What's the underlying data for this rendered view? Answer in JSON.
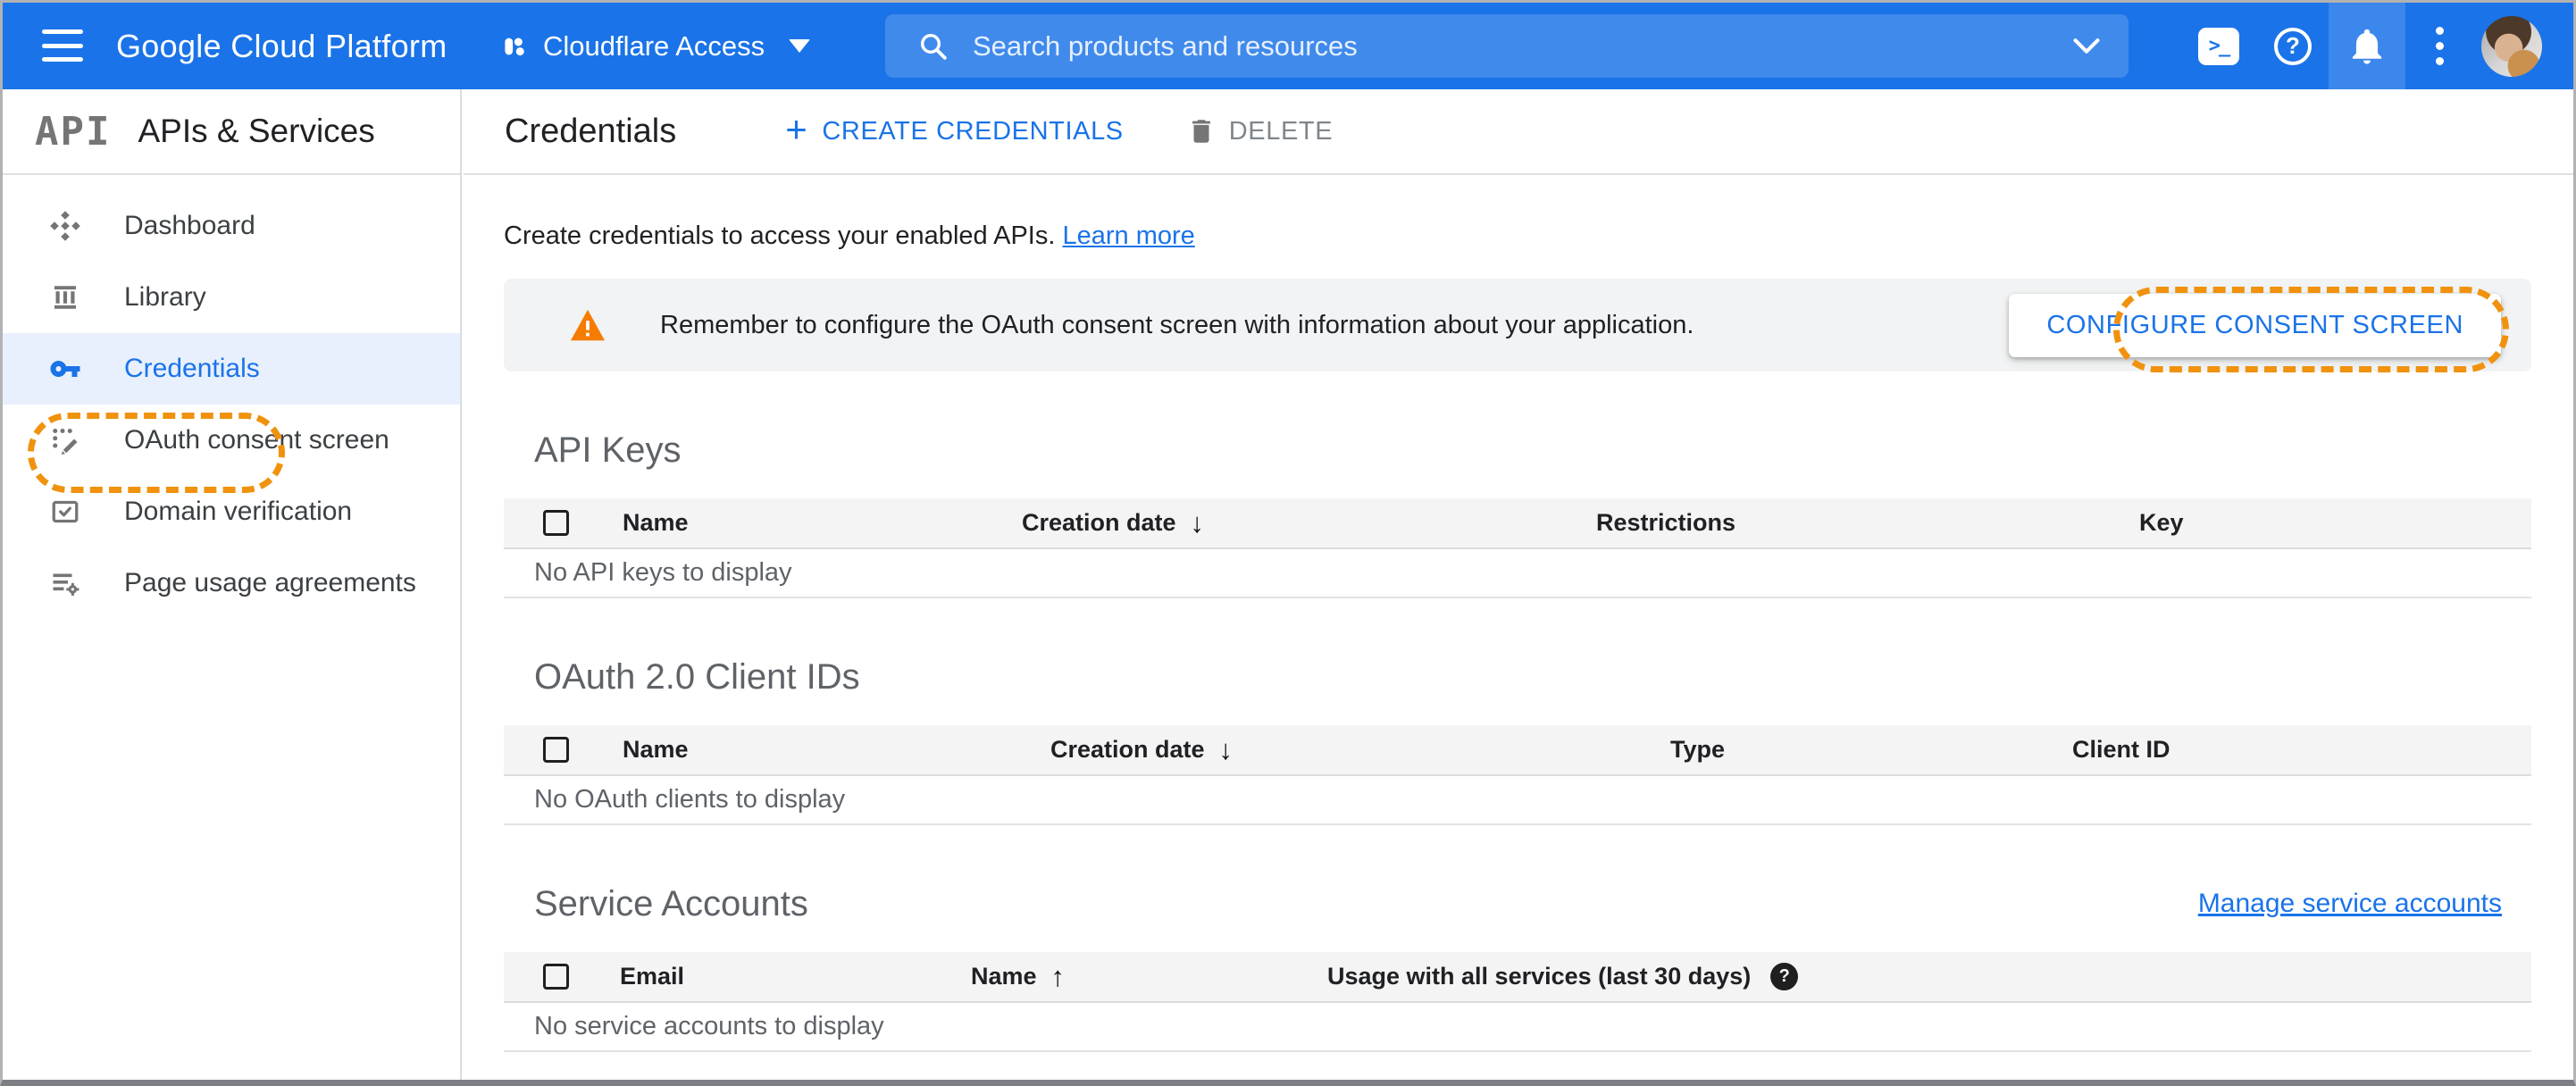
{
  "header": {
    "product_name": "Google Cloud Platform",
    "project_name": "Cloudflare Access",
    "search_placeholder": "Search products and resources",
    "shell_glyph": ">_",
    "help_glyph": "?"
  },
  "sidebar": {
    "logo_text": "API",
    "title": "APIs & Services",
    "items": [
      {
        "label": "Dashboard",
        "selected": false
      },
      {
        "label": "Library",
        "selected": false
      },
      {
        "label": "Credentials",
        "selected": true,
        "annotated": true
      },
      {
        "label": "OAuth consent screen",
        "selected": false
      },
      {
        "label": "Domain verification",
        "selected": false
      },
      {
        "label": "Page usage agreements",
        "selected": false
      }
    ]
  },
  "toolbar": {
    "title": "Credentials",
    "create_icon": "+",
    "create_label": "CREATE CREDENTIALS",
    "delete_label": "DELETE"
  },
  "intro": {
    "text": "Create credentials to access your enabled APIs.",
    "link_label": "Learn more"
  },
  "banner": {
    "message": "Remember to configure the OAuth consent screen with information about your application.",
    "button_label": "CONFIGURE CONSENT SCREEN"
  },
  "sections": {
    "api_keys": {
      "title": "API Keys",
      "columns": [
        "Name",
        "Creation date",
        "Restrictions",
        "Key"
      ],
      "sort": {
        "column": "Creation date",
        "direction": "desc",
        "icon": "↓"
      },
      "empty_text": "No API keys to display",
      "rows": []
    },
    "oauth_clients": {
      "title": "OAuth 2.0 Client IDs",
      "columns": [
        "Name",
        "Creation date",
        "Type",
        "Client ID"
      ],
      "sort": {
        "column": "Creation date",
        "direction": "desc",
        "icon": "↓"
      },
      "empty_text": "No OAuth clients to display",
      "rows": []
    },
    "service_accounts": {
      "title": "Service Accounts",
      "manage_link": "Manage service accounts",
      "columns": [
        "Email",
        "Name",
        "Usage with all services (last 30 days)"
      ],
      "sort": {
        "column": "Name",
        "direction": "asc",
        "icon": "↑"
      },
      "help_glyph": "?",
      "empty_text": "No service accounts to display",
      "rows": []
    }
  },
  "colors": {
    "header_bg": "#1a73e8",
    "accent_blue": "#1a73e8",
    "selected_item_bg": "#e8f0fe",
    "banner_bg": "#f1f3f4",
    "annotation_orange": "#f0920e",
    "warning_orange": "#f57c00",
    "divider_gray": "#e0e0e0"
  }
}
